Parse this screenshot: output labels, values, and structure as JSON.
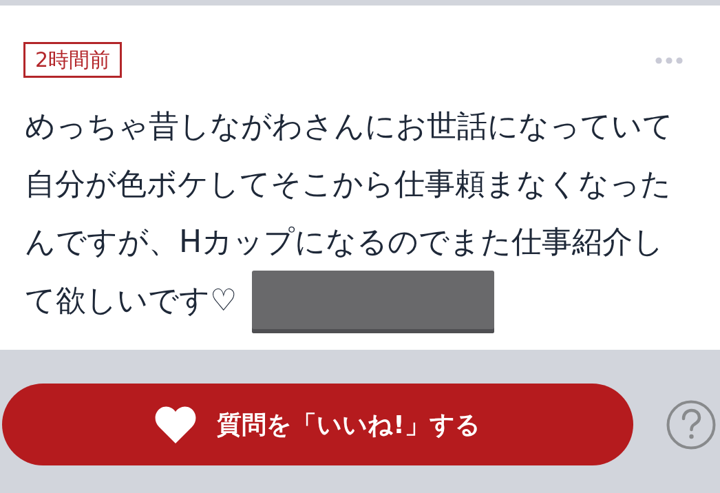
{
  "post": {
    "time_label": "2時間前",
    "body": "めっちゃ昔しながわさんにお世話になっていて自分が色ボケしてそこから仕事頼まなくなったんですが、Hカップになるのでまた仕事紹介して欲しいです♡",
    "redacted": true
  },
  "like_button": {
    "label": "質問を「いいね!」する"
  }
}
